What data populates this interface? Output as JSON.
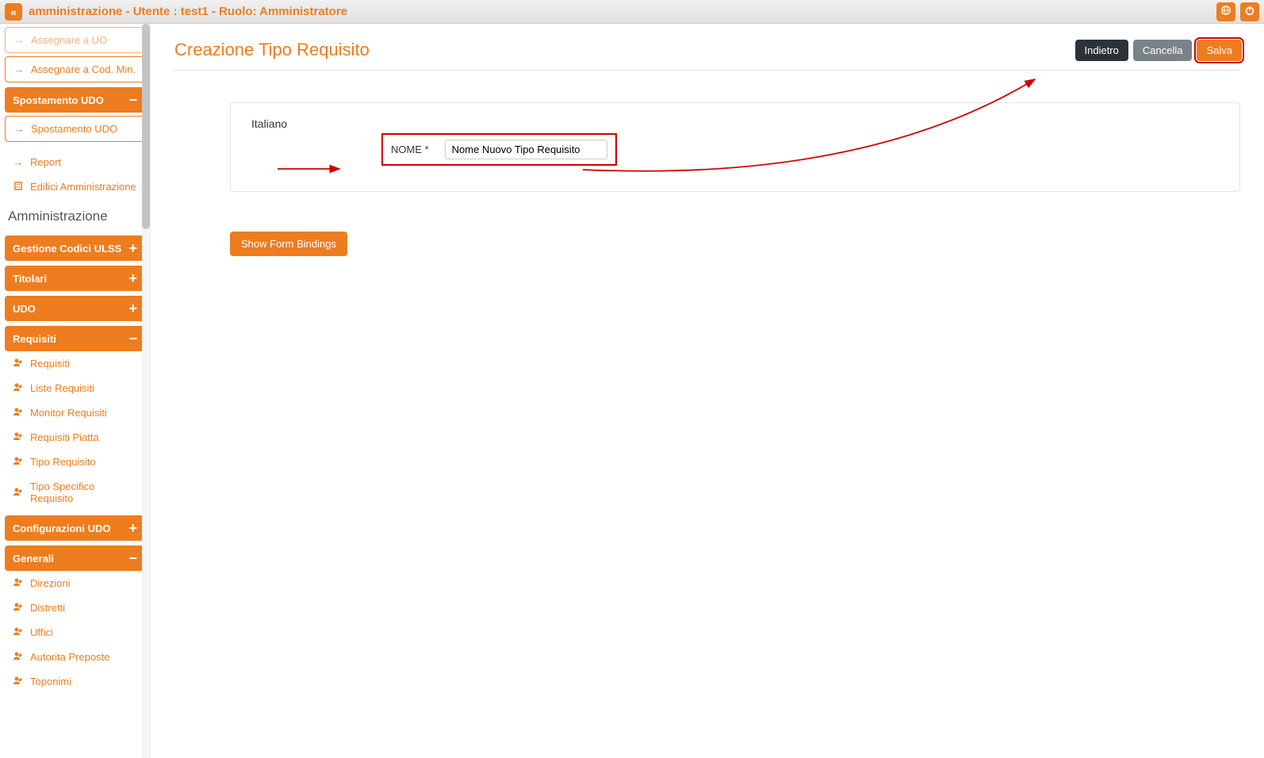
{
  "header": {
    "title": "amministrazione - Utente : test1 - Ruolo: Amministratore"
  },
  "sidebar": {
    "top_items": [
      {
        "icon": "→",
        "label": "Assegnare a UO"
      },
      {
        "icon": "→",
        "label": "Assegnare a Cod. Min."
      }
    ],
    "spostamento": {
      "header": "Spostamento UDO",
      "items": [
        {
          "icon": "→",
          "label": "Spostamento UDO"
        }
      ]
    },
    "loose_items": [
      {
        "icon": "→",
        "label": "Report"
      },
      {
        "icon": "⬚",
        "label": "Edifici Amministrazione"
      }
    ],
    "admin_label": "Amministrazione",
    "gestione_codici": "Gestione Codici ULSS",
    "titolari": "Titolari",
    "udo": "UDO",
    "requisiti": {
      "header": "Requisiti",
      "items": [
        "Requisiti",
        "Liste Requisiti",
        "Monitor Requisiti",
        "Requisiti Piatta",
        "Tipo Requisito",
        "Tipo Specifico Requisito"
      ]
    },
    "config_udo": "Configurazioni UDO",
    "generali": {
      "header": "Generali",
      "items": [
        "Direzioni",
        "Distretti",
        "Uffici",
        "Autorita Preposte",
        "Toponimi"
      ]
    }
  },
  "main": {
    "title": "Creazione Tipo Requisito",
    "actions": {
      "back": "Indietro",
      "cancel": "Cancella",
      "save": "Salva"
    },
    "form": {
      "language": "Italiano",
      "nome_label": "NOME *",
      "nome_value": "Nome Nuovo Tipo Requisito"
    },
    "show_bindings": "Show Form Bindings"
  }
}
